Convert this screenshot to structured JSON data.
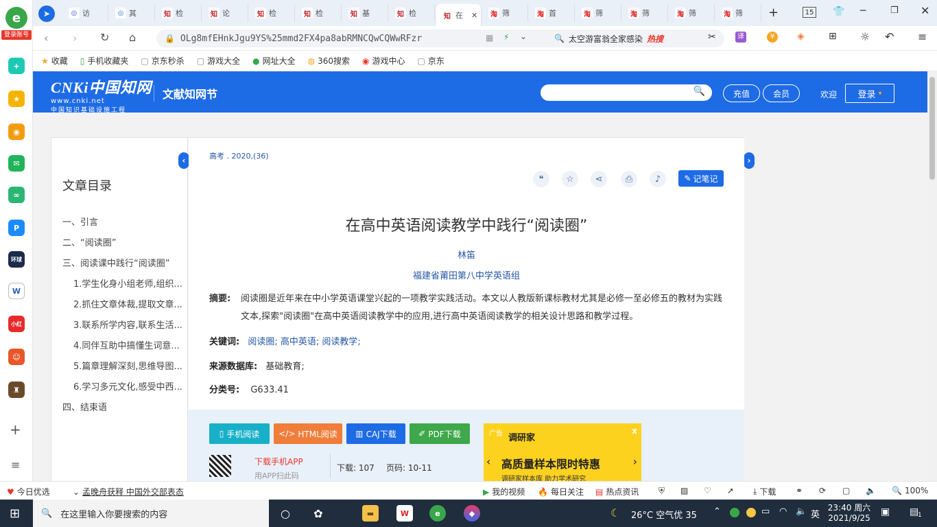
{
  "browser": {
    "login_label": "登录账号",
    "tabs": [
      {
        "label": "访",
        "icon": "paw-icon",
        "color": "#2a5cd6"
      },
      {
        "label": "其",
        "icon": "ie-icon",
        "color": "#2b7cd3"
      },
      {
        "label": "检",
        "icon": "cnki-icon",
        "color": "#c0262c"
      },
      {
        "label": "论",
        "icon": "cnki-icon",
        "color": "#c0262c"
      },
      {
        "label": "检",
        "icon": "cnki-icon",
        "color": "#c0262c"
      },
      {
        "label": "检",
        "icon": "cnki-icon",
        "color": "#c0262c"
      },
      {
        "label": "基",
        "icon": "cnki-icon",
        "color": "#c0262c"
      },
      {
        "label": "检",
        "icon": "cnki-icon",
        "color": "#c0262c"
      },
      {
        "label": "在",
        "icon": "cnki-icon",
        "color": "#c0262c",
        "active": true
      },
      {
        "label": "筛",
        "icon": "taobao-icon",
        "color": "#e02020"
      },
      {
        "label": "首",
        "icon": "taobao-icon",
        "color": "#e02020"
      },
      {
        "label": "筛",
        "icon": "taobao-icon",
        "color": "#e02020"
      },
      {
        "label": "筛",
        "icon": "taobao-icon",
        "color": "#e02020"
      },
      {
        "label": "筛",
        "icon": "taobao-icon",
        "color": "#e02020"
      },
      {
        "label": "筛",
        "icon": "taobao-icon",
        "color": "#e02020"
      }
    ],
    "tab_count": "15",
    "url": "OLg8mfEHnkJgu9YS%25mmd2FX4pa8abRMNCQwCQWwRFzr",
    "search_text": "太空游富翁全家感染",
    "hot_label": "热搜",
    "bookmarks": [
      "收藏",
      "手机收藏夹",
      "京东秒杀",
      "游戏大全",
      "网址大全",
      "360搜索",
      "游戏中心",
      "京东"
    ]
  },
  "cnki": {
    "logo_text": "CNKi中国知网",
    "logo_url": "www.cnki.net",
    "logo_sub": "中国知识基础设施工程",
    "site_name": "文献知网节",
    "recharge": "充值",
    "member": "会员",
    "welcome": "欢迎",
    "login": "登录"
  },
  "toc": {
    "title": "文章目录",
    "items": [
      "一、引言",
      "二、“阅读圈”",
      "三、阅读课中践行“阅读圈”",
      "1.学生化身小组老师,组织...",
      "2.抓住文章体裁,提取文章...",
      "3.联系所学内容,联系生活...",
      "4.同伴互助中搞懂生词意...",
      "5.篇章理解深刻,思维导图...",
      "6.学习多元文化,感受中西...",
      "四、结束语"
    ]
  },
  "article": {
    "source": "高考 . 2020,(36)",
    "note_label": "记笔记",
    "title": "在高中英语阅读教学中践行“阅读圈”",
    "author": "林笛",
    "org": "福建省莆田第八中学英语组",
    "abstract_label": "摘要:",
    "abstract": "阅读圈是近年来在中小学英语课堂兴起的一项教学实践活动。本文以人教版新课标教材尤其是必修一至必修五的教材为实践文本,探索\"阅读圈\"在高中英语阅读教学中的应用,进行高中英语阅读教学的相关设计思路和教学过程。",
    "keywords_label": "关键词:",
    "keywords": "阅读圈;   高中英语;   阅读教学;",
    "db_label": "来源数据库:",
    "db": "基础教育;",
    "class_label": "分类号:",
    "class": "G633.41"
  },
  "downloads": {
    "buttons": [
      {
        "label": "手机阅读",
        "color": "#18b0c8"
      },
      {
        "label": "HTML阅读",
        "color": "#f07d3a"
      },
      {
        "label": "CAJ下载",
        "color": "#1e6be6"
      },
      {
        "label": "PDF下载",
        "color": "#3fa84a"
      }
    ],
    "app_label": "下载手机APP",
    "app_sub": "用APP扫此码",
    "download_count": "下载: 107",
    "pages": "页码: 10-11",
    "ad": {
      "tag": "广告",
      "brand": "调研家",
      "headline": "高质量样本限时特惠",
      "sub": "调研家样本库 助力学术研究"
    }
  },
  "statusbar": {
    "left1": "今日优选",
    "news": "孟晚舟获释 中国外交部表态",
    "video": "我的视频",
    "daily": "每日关注",
    "hot": "热点资讯",
    "download": "下载",
    "zoom": "100%"
  },
  "taskbar": {
    "search_placeholder": "在这里输入你要搜索的内容",
    "weather": "26°C  空气优 35",
    "ime": "英",
    "time": "23:40 周六",
    "date": "2021/9/25",
    "notify_count": "1"
  }
}
